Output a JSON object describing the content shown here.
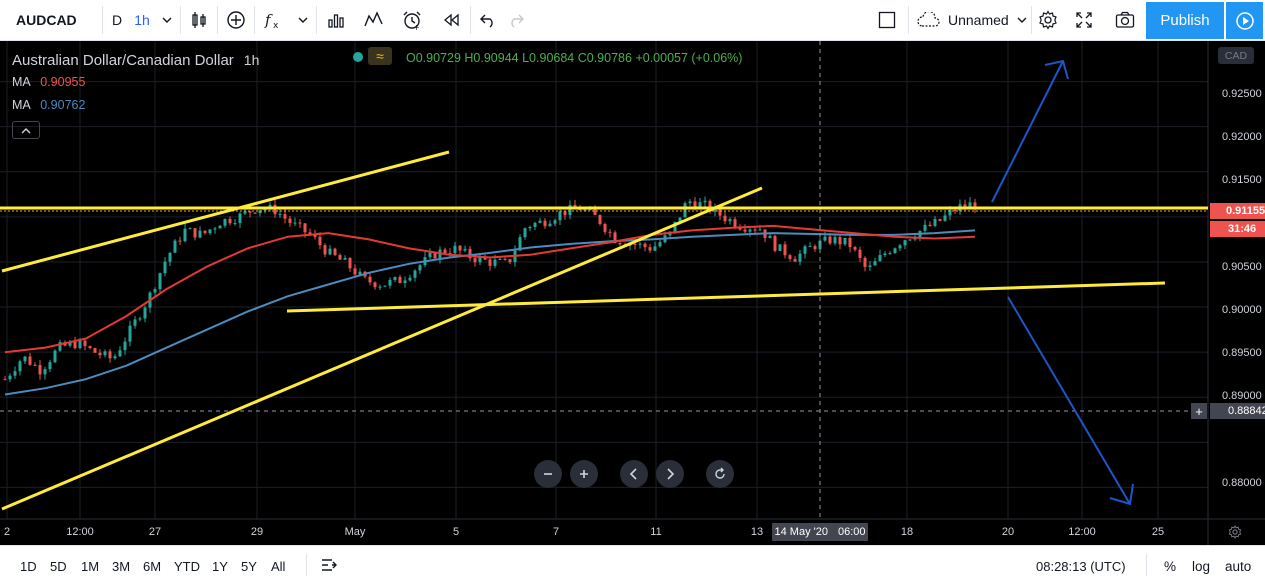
{
  "toolbar": {
    "symbol": "AUDCAD",
    "interval_day": "D",
    "interval_active": "1h",
    "layout_name": "Unnamed",
    "publish_label": "Publish",
    "icons": [
      "chevron-down-icon",
      "candles-icon",
      "plus-circle-icon",
      "fx-icon",
      "bar-chart-icon",
      "indicator-icon",
      "alarm-icon",
      "replay-icon",
      "undo-icon",
      "redo-icon",
      "checkbox-icon",
      "cloud-icon",
      "gear-icon",
      "fullscreen-icon",
      "camera-icon",
      "play-icon"
    ]
  },
  "legend": {
    "title": "Australian Dollar/Canadian Dollar",
    "interval": "1h",
    "open": "O0.90729",
    "high": "H0.90944",
    "low": "L0.90684",
    "close": "C0.90786",
    "change": "+0.00057 (+0.06%)",
    "ma1_name": "MA",
    "ma1_value": "0.90955",
    "ma2_name": "MA",
    "ma2_value": "0.90762"
  },
  "price_axis": {
    "currency": "CAD",
    "labels": [
      "0.92500",
      "0.92000",
      "0.91500",
      "0.90500",
      "0.90000",
      "0.89500",
      "0.89000",
      "0.88000"
    ],
    "last_price": "0.91155",
    "countdown": "31:46",
    "crosshair_price": "0.88842"
  },
  "time_axis": {
    "labels": [
      "2",
      "12:00",
      "27",
      "29",
      "May",
      "5",
      "7",
      "11",
      "13",
      "18",
      "20",
      "12:00",
      "25"
    ],
    "crosshair_date": "14 May '20",
    "crosshair_time": "06:00"
  },
  "bottombar": {
    "ranges": [
      "1D",
      "5D",
      "1M",
      "3M",
      "6M",
      "YTD",
      "1Y",
      "5Y",
      "All"
    ],
    "clock": "08:28:13 (UTC)",
    "percent": "%",
    "log": "log",
    "auto": "auto"
  },
  "chart_data": {
    "type": "candlestick",
    "symbol": "AUDCAD",
    "interval": "1h",
    "x": [
      "2",
      "12:00",
      "27",
      "29",
      "May",
      "5",
      "7",
      "11",
      "13",
      "18",
      "20",
      "12:00",
      "25"
    ],
    "ylim": [
      0.8765,
      0.9295
    ],
    "colors": {
      "up": "#26a69a",
      "down": "#ef5350",
      "ma1": "#e53935",
      "ma2": "#4b8bbe",
      "drawing": "#ffeb3b",
      "arrow": "#1e56c8"
    },
    "close_path": [
      0.892,
      0.8945,
      0.893,
      0.8955,
      0.896,
      0.895,
      0.8942,
      0.8975,
      0.901,
      0.9055,
      0.9085,
      0.908,
      0.9095,
      0.91,
      0.911,
      0.9108,
      0.9092,
      0.908,
      0.906,
      0.9048,
      0.903,
      0.9025,
      0.903,
      0.9045,
      0.906,
      0.9065,
      0.9055,
      0.905,
      0.9048,
      0.909,
      0.9095,
      0.9105,
      0.911,
      0.9098,
      0.9075,
      0.907,
      0.9065,
      0.908,
      0.9118,
      0.9112,
      0.91,
      0.909,
      0.9088,
      0.9065,
      0.9055,
      0.9068,
      0.9075,
      0.907,
      0.904,
      0.906,
      0.9075,
      0.9085,
      0.9095,
      0.911,
      0.9115
    ],
    "ma1_path": [
      0.895,
      0.8955,
      0.8965,
      0.899,
      0.902,
      0.9045,
      0.9065,
      0.9078,
      0.9082,
      0.9075,
      0.9065,
      0.9058,
      0.9055,
      0.9058,
      0.9065,
      0.9072,
      0.908,
      0.9085,
      0.9088,
      0.909,
      0.9086,
      0.9082,
      0.9078,
      0.9076,
      0.9078
    ],
    "ma2_path": [
      0.8903,
      0.891,
      0.892,
      0.8935,
      0.8955,
      0.8975,
      0.8995,
      0.9012,
      0.9025,
      0.9038,
      0.9048,
      0.9055,
      0.906,
      0.9066,
      0.907,
      0.9073,
      0.9075,
      0.9078,
      0.908,
      0.9082,
      0.9081,
      0.908,
      0.908,
      0.9082,
      0.9085
    ],
    "horizontal_level": 0.9117
  }
}
